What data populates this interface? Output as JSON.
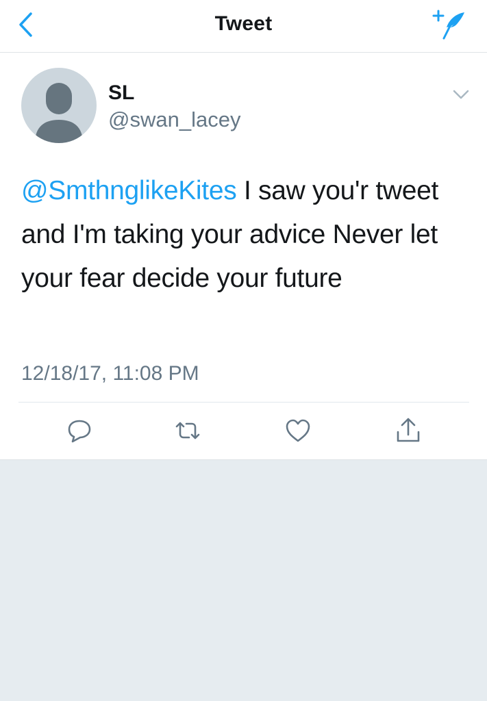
{
  "navbar": {
    "title": "Tweet",
    "back_icon": "chevron-left-icon",
    "compose_icon": "compose-tweet-icon",
    "accent_color": "#1da1f2"
  },
  "tweet": {
    "author": {
      "display_name": "SL",
      "handle": "@swan_lacey",
      "avatar": "default-avatar-icon"
    },
    "text": {
      "mention": "@SmthnglikeKites",
      "body": " I saw you'r tweet and I'm taking your advice Never let your fear decide your future"
    },
    "timestamp": "12/18/17, 11:08 PM",
    "actions": [
      {
        "name": "reply",
        "icon": "reply-icon"
      },
      {
        "name": "retweet",
        "icon": "retweet-icon"
      },
      {
        "name": "like",
        "icon": "heart-icon"
      },
      {
        "name": "share",
        "icon": "share-icon"
      }
    ]
  },
  "colors": {
    "text_primary": "#14171a",
    "text_secondary": "#657786",
    "background": "#e6ecf0",
    "avatar_bg": "#ccd6dd",
    "avatar_fg": "#66757f"
  }
}
